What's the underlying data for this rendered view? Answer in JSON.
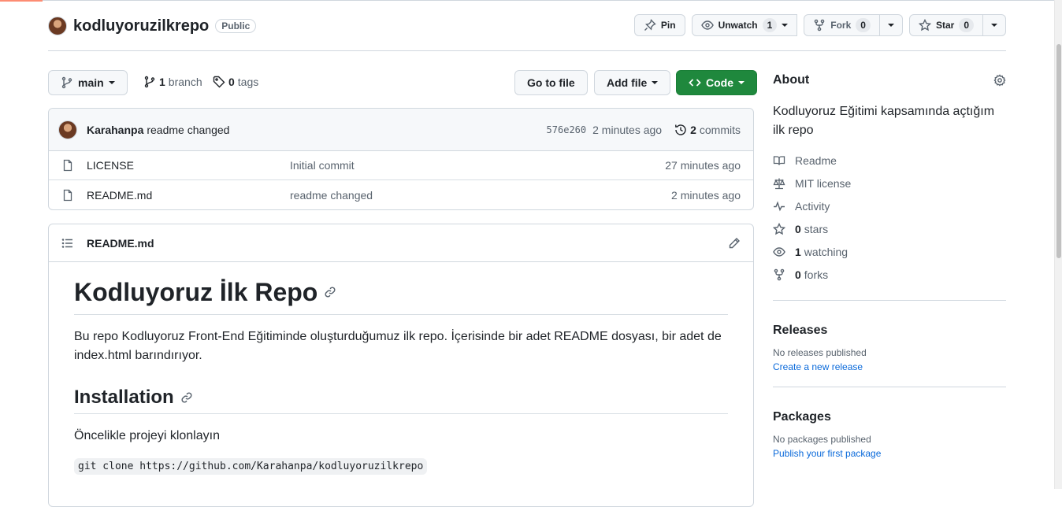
{
  "repo": {
    "name": "kodluyoruzilkrepo",
    "visibility": "Public"
  },
  "header_actions": {
    "pin_label": "Pin",
    "watch_label": "Unwatch",
    "watch_count": "1",
    "fork_label": "Fork",
    "fork_count": "0",
    "star_label": "Star",
    "star_count": "0"
  },
  "toolbar": {
    "branch_name": "main",
    "branch_count": "1",
    "branch_label": "branch",
    "tag_count": "0",
    "tag_label": "tags",
    "goto_label": "Go to file",
    "add_file_label": "Add file",
    "code_label": "Code"
  },
  "latest_commit": {
    "author": "Karahanpa",
    "message": "readme changed",
    "sha": "576e260",
    "time": "2 minutes ago",
    "commit_count": "2",
    "commit_label": "commits"
  },
  "files": [
    {
      "name": "LICENSE",
      "message": "Initial commit",
      "age": "27 minutes ago"
    },
    {
      "name": "README.md",
      "message": "readme changed",
      "age": "2 minutes ago"
    }
  ],
  "readme": {
    "file_label": "README.md",
    "h1": "Kodluyoruz İlk Repo",
    "intro": "Bu repo Kodluyoruz Front-End Eğitiminde oluşturduğumuz ilk repo. İçerisinde bir adet README dosyası, bir adet de index.html barındırıyor.",
    "h2": "Installation",
    "install_text": "Öncelikle projeyi klonlayın",
    "clone_cmd": "git clone https://github.com/Karahanpa/kodluyoruzilkrepo"
  },
  "about": {
    "heading": "About",
    "description": "Kodluyoruz Eğitimi kapsamında açtığım ilk repo",
    "items": [
      {
        "icon": "book-icon",
        "label": "Readme"
      },
      {
        "icon": "law-icon",
        "label": "MIT license"
      },
      {
        "icon": "pulse-icon",
        "label": "Activity"
      },
      {
        "icon": "star-icon",
        "count": "0",
        "label": "stars"
      },
      {
        "icon": "eye-icon",
        "count": "1",
        "label": "watching"
      },
      {
        "icon": "fork-icon",
        "count": "0",
        "label": "forks"
      }
    ]
  },
  "releases": {
    "heading": "Releases",
    "empty_text": "No releases published",
    "link": "Create a new release"
  },
  "packages": {
    "heading": "Packages",
    "empty_text": "No packages published",
    "link": "Publish your first package"
  },
  "colors": {
    "accent_green": "#1f883d",
    "link_blue": "#0969da",
    "progress_orange": "#fd8c73"
  }
}
